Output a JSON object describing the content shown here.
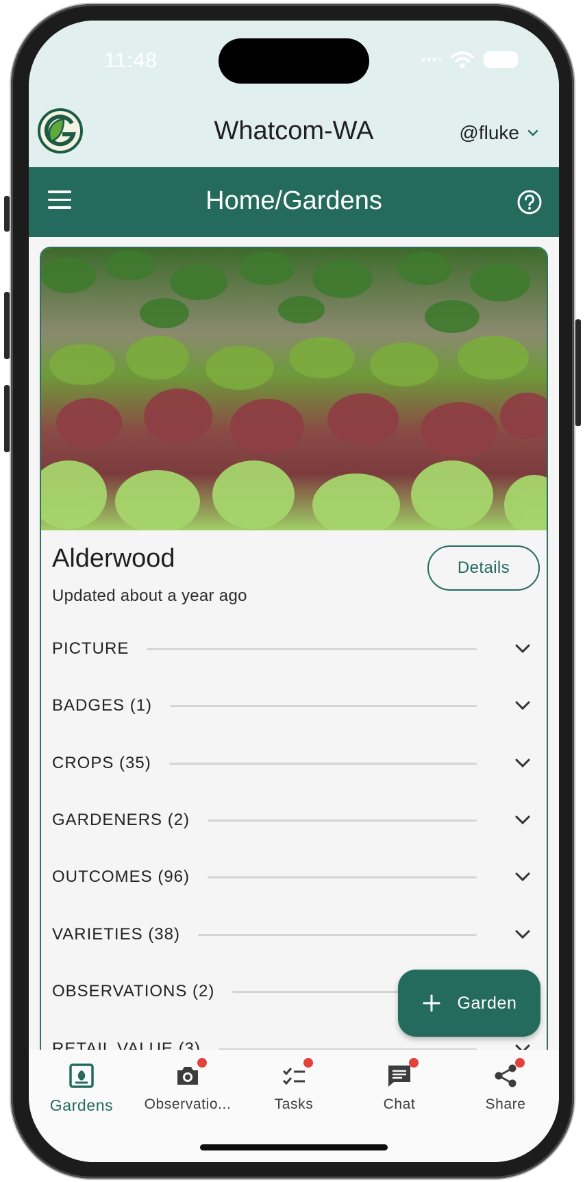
{
  "status_bar": {
    "time": "11:48"
  },
  "header": {
    "region": "Whatcom-WA",
    "user": "@fluke"
  },
  "appbar": {
    "title": "Home/Gardens"
  },
  "garden": {
    "name": "Alderwood",
    "updated": "Updated about a year ago",
    "details_label": "Details",
    "sections": [
      {
        "label": "PICTURE"
      },
      {
        "label": "BADGES  (1)"
      },
      {
        "label": "CROPS  (35)"
      },
      {
        "label": "GARDENERS  (2)"
      },
      {
        "label": "OUTCOMES  (96)"
      },
      {
        "label": "VARIETIES  (38)"
      },
      {
        "label": "OBSERVATIONS  (2)"
      },
      {
        "label": "RETAIL VALUE  (3)"
      }
    ]
  },
  "fab": {
    "label": "Garden"
  },
  "bottom_nav": {
    "items": [
      {
        "label": "Gardens",
        "icon": "garden-icon",
        "active": true
      },
      {
        "label": "Observatio...",
        "icon": "camera-icon",
        "badge": true
      },
      {
        "label": "Tasks",
        "icon": "tasks-icon",
        "badge": true
      },
      {
        "label": "Chat",
        "icon": "chat-icon",
        "badge": true
      },
      {
        "label": "Share",
        "icon": "share-icon",
        "badge": true
      }
    ]
  },
  "colors": {
    "primary": "#246b5e",
    "header_bg": "#e1f0ef",
    "badge": "#e2423a"
  }
}
